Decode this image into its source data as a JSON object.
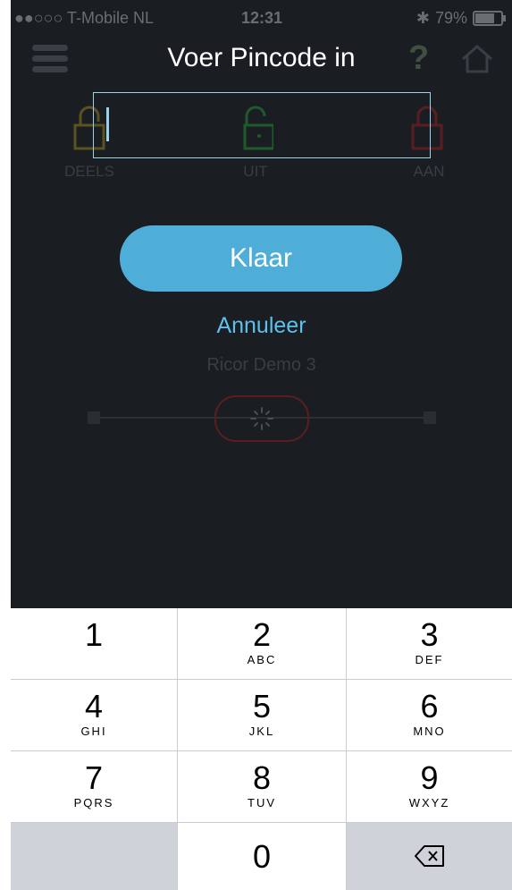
{
  "status_bar": {
    "carrier": "●●○○○ T-Mobile NL",
    "time": "12:31",
    "battery": "79%",
    "battery_level": 0.79
  },
  "background_app": {
    "modes": [
      {
        "label": "DEELS",
        "color": "#5a5320"
      },
      {
        "label": "UIT",
        "color": "#1f5a2c"
      },
      {
        "label": "AAN",
        "color": "#5a1e22"
      }
    ],
    "device_name": "Ricor Demo 3",
    "help_icon": "question-icon",
    "home_icon": "home-icon",
    "menu_icon": "hamburger-menu-icon"
  },
  "dialog": {
    "title": "Voer Pincode in",
    "pin_value": "",
    "done_label": "Klaar",
    "cancel_label": "Annuleer",
    "accent_color": "#4eaed7"
  },
  "keypad": {
    "keys": [
      {
        "num": "1",
        "letters": ""
      },
      {
        "num": "2",
        "letters": "ABC"
      },
      {
        "num": "3",
        "letters": "DEF"
      },
      {
        "num": "4",
        "letters": "GHI"
      },
      {
        "num": "5",
        "letters": "JKL"
      },
      {
        "num": "6",
        "letters": "MNO"
      },
      {
        "num": "7",
        "letters": "PQRS"
      },
      {
        "num": "8",
        "letters": "TUV"
      },
      {
        "num": "9",
        "letters": "WXYZ"
      },
      {
        "num": "0",
        "letters": ""
      }
    ],
    "delete_icon": "backspace-icon"
  }
}
